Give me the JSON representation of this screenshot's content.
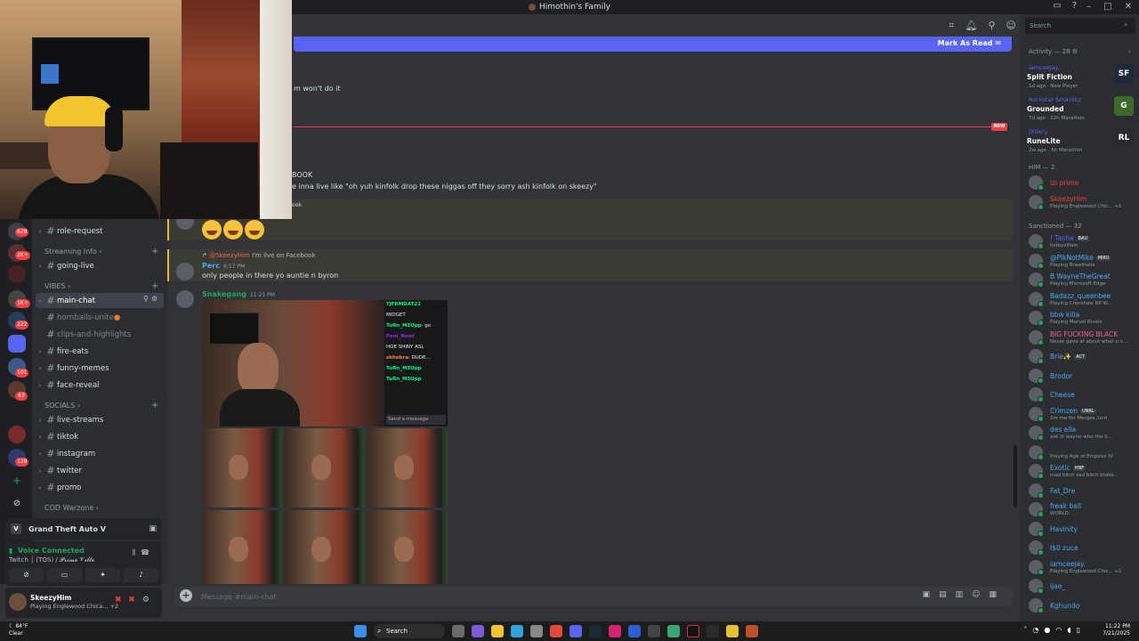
{
  "window": {
    "title": "Himothin's Family"
  },
  "header": {
    "mark_as_read": "Mark As Read"
  },
  "search": {
    "placeholder": "Search"
  },
  "channels": {
    "cats": {
      "streaming": "Streaming Info",
      "vibes": "VIBES",
      "socials": "SOCIALS",
      "cod": "COD Warzone"
    },
    "items": {
      "role_request": "role-request",
      "going_live": "going-live",
      "main_chat": "main-chat",
      "hornballs": "hornballs-unite",
      "clips": "clips-and-highlights",
      "fire_eats": "fire-eats",
      "funny_memes": "funny-memes",
      "face_reveal": "face-reveal",
      "live_streams": "live-streams",
      "tiktok": "tiktok",
      "instagram": "instagram",
      "twitter": "twitter",
      "promo": "promo"
    }
  },
  "server_badges": [
    "628",
    "2K+",
    "1K+",
    "222",
    "101",
    "63",
    "128"
  ],
  "activity_card": {
    "game": "Grand Theft Auto V"
  },
  "voice": {
    "status": "Voice Connected",
    "sub": "Twitch │ (TOS) / 𝓟𝓻𝓲𝓶𝓮 𝓥𝓲𝓵𝓵𝓮"
  },
  "user": {
    "name": "SkeezyHim",
    "status": "Playing Englewood Chica...",
    "extra": "+2"
  },
  "messages": {
    "frag1": "m won't do it",
    "frag2": "BOOK",
    "frag3": "e inna live like \"oh yuh kinfolk drop these niggas off they sorry ash kinfolk on skeezy\"",
    "frag4": "ook",
    "reply_name": "@SkeezyHim",
    "reply_text": "I'm live on Facebook",
    "perc_name": "Perc",
    "perc_time": "6:57 PM",
    "perc_text": "only people in there yo auntie n byron",
    "snake_name": "Snakegang",
    "snake_time": "11:21 PM",
    "new_tag": "NEW"
  },
  "stream_chat": {
    "l1_name": "TJFRMDAT22",
    "l1_text": "MIDGET",
    "l2_name": "TuRn_M3Upp",
    "l2_text": "go",
    "l3_name": "Peni_Nowi",
    "l3_text": "HOE SHINY ASL",
    "l4_name": "zkhobra",
    "l4_text": "DUDE...",
    "l5_name": "TuRn_M3Upp",
    "l6_name": "TuRn_M3Upp",
    "send": "Send a message"
  },
  "composer": {
    "placeholder": "Message #main-chat"
  },
  "members": {
    "activity_head": "Activity — 28",
    "cards": [
      {
        "name": "iamceejay.",
        "game": "Split Fiction",
        "meta": "1d ago  ·  New Player",
        "art": "SF",
        "color": "#1e2a3a"
      },
      {
        "name": "Rockstar Smackkz",
        "game": "Grounded",
        "meta": "7d ago  ·  12h Marathon",
        "art": "G",
        "color": "#3a6a2a"
      },
      {
        "name": "|X0ery",
        "game": "RuneLite",
        "meta": "2w ago  ·  6h Marathon",
        "art": "RL",
        "color": "#2a2a2a"
      }
    ],
    "him_head": "HIM — 2",
    "him": [
      {
        "name": "izi prime",
        "status": "",
        "color": "#f23f43"
      },
      {
        "name": "SkeezyHim",
        "status": "Playing Englewood Chic... +1",
        "color": "#f23f43"
      }
    ],
    "sanct_head": "Sanctioned — 32",
    "sanct": [
      {
        "name": "! Tasha",
        "status": "itsfeyvillain",
        "color": "#5865f2",
        "tag": "BAU"
      },
      {
        "name": "@PlkNotMike",
        "status": "Playing Brawlhalla",
        "color": "#4aa8ff",
        "tag": "MIKU"
      },
      {
        "name": "B WayneTheGreat",
        "status": "Playing Microsoft Edge",
        "color": "#4aa8ff",
        "tag": ""
      },
      {
        "name": "Badazz_queenbee",
        "status": "Playing Crenshaw RP W...",
        "color": "#4aa8ff",
        "tag": ""
      },
      {
        "name": "bbw killa",
        "status": "Playing Marvel Rivals",
        "color": "#4aa8ff",
        "tag": ""
      },
      {
        "name": "BIG FUCKING BLACK",
        "status": "Never gave af about what u n...",
        "color": "#f06090",
        "tag": ""
      },
      {
        "name": "Brie✨",
        "status": "",
        "color": "#4aa8ff",
        "tag": "ACT"
      },
      {
        "name": "Brodor",
        "status": "",
        "color": "#4aa8ff",
        "tag": ""
      },
      {
        "name": "Cheese",
        "status": "",
        "color": "#4aa8ff",
        "tag": ""
      },
      {
        "name": "Crimzen",
        "status": "2m me for Merges /ucri",
        "color": "#4aa8ff",
        "tag": "UNRL"
      },
      {
        "name": "des ella",
        "status": "ask lil wayne who the S...",
        "color": "#4aa8ff",
        "tag": ""
      },
      {
        "name": "",
        "status": "Playing Age of Empires IV",
        "color": "#4aa8ff",
        "tag": ""
      },
      {
        "name": "Exotic",
        "status": "mad bitch sad bitch broke...",
        "color": "#4aa8ff",
        "tag": "HNF"
      },
      {
        "name": "Fat_Dre",
        "status": "",
        "color": "#4aa8ff",
        "tag": ""
      },
      {
        "name": "freak ball",
        "status": "WORLD",
        "color": "#4aa8ff",
        "tag": ""
      },
      {
        "name": "Havinity",
        "status": "",
        "color": "#4aa8ff",
        "tag": ""
      },
      {
        "name": "I$0 zuce",
        "status": "",
        "color": "#4aa8ff",
        "tag": ""
      },
      {
        "name": "iamceejay.",
        "status": "Playing Englewood Chic... +1",
        "color": "#4aa8ff",
        "tag": ""
      },
      {
        "name": "ijae_",
        "status": "",
        "color": "#4aa8ff",
        "tag": ""
      },
      {
        "name": "Kghundo",
        "status": "",
        "color": "#4aa8ff",
        "tag": ""
      }
    ]
  },
  "taskbar": {
    "temp": "84°F",
    "weather": "Clear",
    "search": "Search",
    "time": "11:22 PM",
    "date": "7/21/2025"
  },
  "colors": {
    "accent": "#5865f2",
    "online": "#23a55a",
    "danger": "#f23f43",
    "highlight": "#f0b232"
  }
}
